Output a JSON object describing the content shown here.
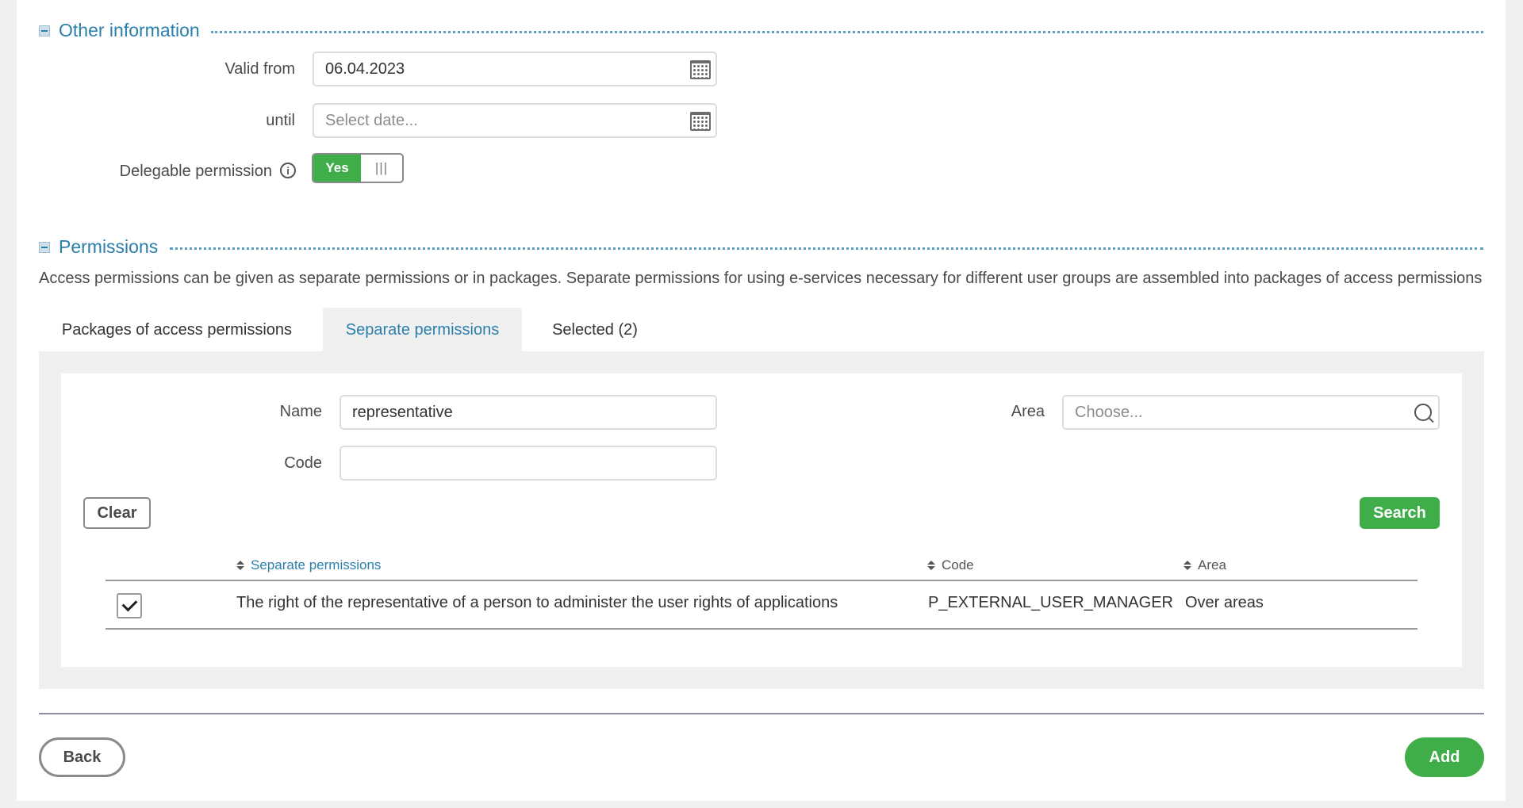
{
  "other_info": {
    "title": "Other information",
    "valid_from_label": "Valid from",
    "valid_from_value": "06.04.2023",
    "until_label": "until",
    "until_placeholder": "Select date...",
    "delegable_label": "Delegable permission",
    "delegable_toggle_label": "Yes",
    "delegable_on": true
  },
  "permissions": {
    "title": "Permissions",
    "description": "Access permissions can be given as separate permissions or in packages. Separate permissions for using e-services necessary for different user groups are assembled into packages of access permissions",
    "tabs": [
      {
        "label": "Packages of access permissions",
        "active": false
      },
      {
        "label": "Separate permissions",
        "active": true
      },
      {
        "label": "Selected (2)",
        "active": false
      }
    ],
    "filters": {
      "name_label": "Name",
      "name_value": "representative",
      "code_label": "Code",
      "code_value": "",
      "area_label": "Area",
      "area_placeholder": "Choose...",
      "clear_label": "Clear",
      "search_label": "Search"
    },
    "table": {
      "columns": [
        "Separate permissions",
        "Code",
        "Area"
      ],
      "rows": [
        {
          "checked": true,
          "name": "The right of the representative of a person to administer the user rights of applications",
          "code": "P_EXTERNAL_USER_MANAGER",
          "area": "Over areas"
        }
      ]
    }
  },
  "footer": {
    "back_label": "Back",
    "add_label": "Add"
  },
  "colors": {
    "accent": "#2a7fab",
    "success": "#3fae49",
    "panel": "#f0f0f0"
  }
}
